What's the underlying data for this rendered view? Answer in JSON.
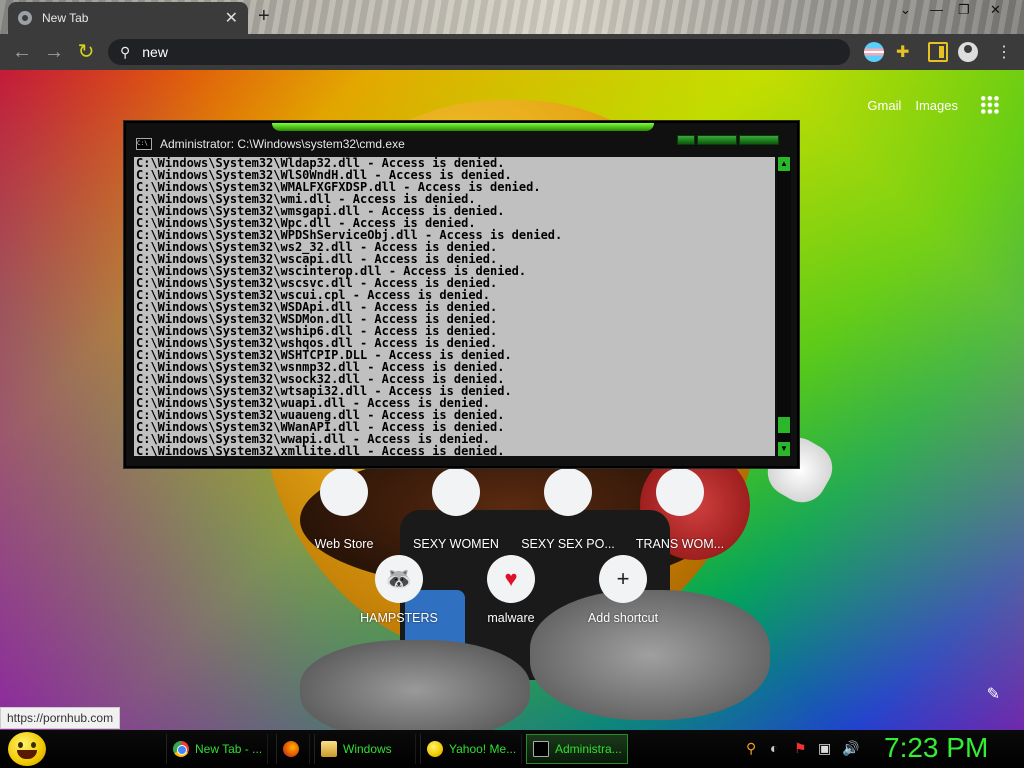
{
  "browser": {
    "tab": {
      "title": "New Tab",
      "close": "✕"
    },
    "new_tab": "+",
    "window_controls": {
      "dropdown": "⌄",
      "minimize": "—",
      "restore": "❐",
      "close": "✕"
    },
    "omnibox_value": "new",
    "nav": {
      "back": "←",
      "forward": "→",
      "reload": "↻"
    },
    "menu": "⋮"
  },
  "newtab": {
    "links": {
      "gmail": "Gmail",
      "images": "Images"
    },
    "shortcuts_row1": [
      {
        "label": "Web Store"
      },
      {
        "label": "SEXY WOMEN"
      },
      {
        "label": "SEXY SEX PO..."
      },
      {
        "label": "TRANS WOM..."
      }
    ],
    "shortcuts_row2": [
      {
        "label": "HAMPSTERS",
        "glyph": "🦝"
      },
      {
        "label": "malware",
        "glyph": "♥"
      },
      {
        "label": "Add shortcut",
        "glyph": "+"
      }
    ],
    "customize_icon": "✎"
  },
  "status_url": "https://pornhub.com",
  "cmd": {
    "title": "Administrator: C:\\Windows\\system32\\cmd.exe",
    "icon_text": "C:\\",
    "lines": [
      "C:\\Windows\\System32\\Wldap32.dll - Access is denied.",
      "C:\\Windows\\System32\\WlS0WndH.dll - Access is denied.",
      "C:\\Windows\\System32\\WMALFXGFXDSP.dll - Access is denied.",
      "C:\\Windows\\System32\\wmi.dll - Access is denied.",
      "C:\\Windows\\System32\\wmsgapi.dll - Access is denied.",
      "C:\\Windows\\System32\\Wpc.dll - Access is denied.",
      "C:\\Windows\\System32\\WPDShServiceObj.dll - Access is denied.",
      "C:\\Windows\\System32\\ws2_32.dll - Access is denied.",
      "C:\\Windows\\System32\\wscapi.dll - Access is denied.",
      "C:\\Windows\\System32\\wscinterop.dll - Access is denied.",
      "C:\\Windows\\System32\\wscsvc.dll - Access is denied.",
      "C:\\Windows\\System32\\wscui.cpl - Access is denied.",
      "C:\\Windows\\System32\\WSDApi.dll - Access is denied.",
      "C:\\Windows\\System32\\WSDMon.dll - Access is denied.",
      "C:\\Windows\\System32\\wship6.dll - Access is denied.",
      "C:\\Windows\\System32\\wshqos.dll - Access is denied.",
      "C:\\Windows\\System32\\WSHTCPIP.DLL - Access is denied.",
      "C:\\Windows\\System32\\wsnmp32.dll - Access is denied.",
      "C:\\Windows\\System32\\wsock32.dll - Access is denied.",
      "C:\\Windows\\System32\\wtsapi32.dll - Access is denied.",
      "C:\\Windows\\System32\\wuapi.dll - Access is denied.",
      "C:\\Windows\\System32\\wuaueng.dll - Access is denied.",
      "C:\\Windows\\System32\\WWanAPI.dll - Access is denied.",
      "C:\\Windows\\System32\\wwapi.dll - Access is denied.",
      "C:\\Windows\\System32\\xmllite.dll - Access is denied."
    ]
  },
  "taskbar": {
    "tasks": [
      {
        "label": "New Tab - ...",
        "icon": "chrome-icon"
      },
      {
        "label": "",
        "icon": "firefox-icon"
      },
      {
        "label": "Windows",
        "icon": "folder-icon"
      },
      {
        "label": "Yahoo! Me...",
        "icon": "yahoo-messenger-icon"
      },
      {
        "label": "Administra...",
        "icon": "cmd-icon"
      }
    ],
    "tray_icons": [
      "search-icon",
      "messenger-icon",
      "flag-icon",
      "network-icon",
      "volume-icon"
    ],
    "clock": "7:23 PM"
  },
  "colors": {
    "accent_green": "#33dd33",
    "cmd_bg": "#c0c0c0",
    "toolbar": "#3b3b3b"
  }
}
